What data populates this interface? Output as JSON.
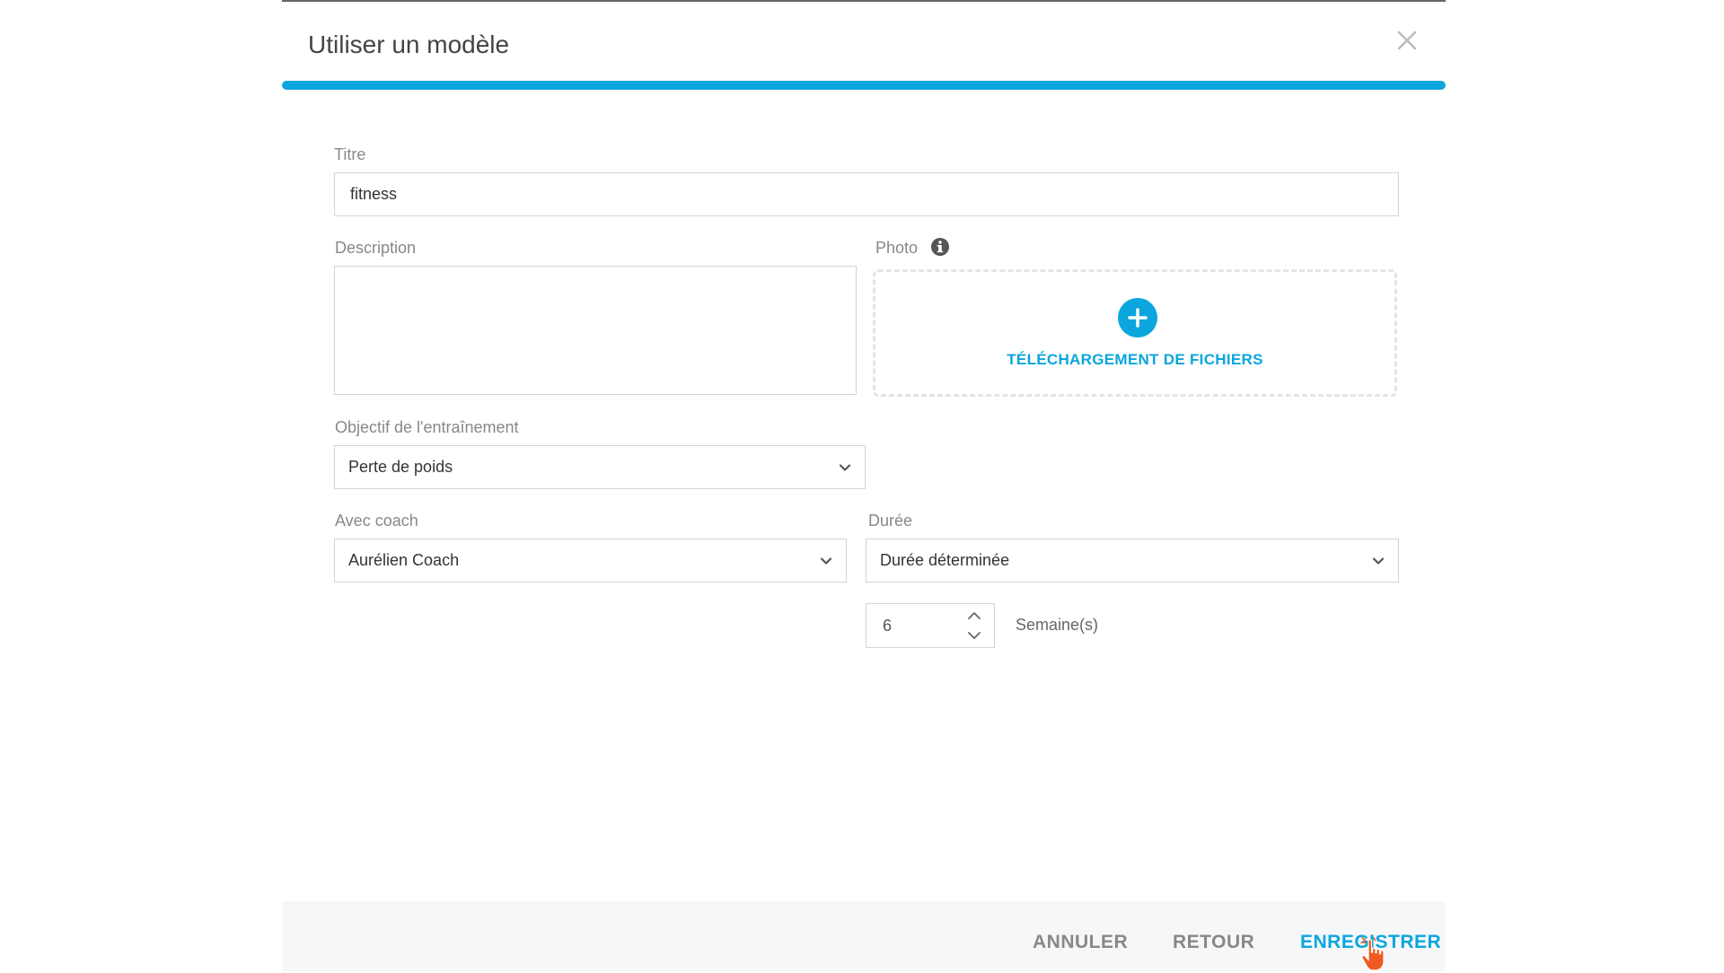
{
  "modal": {
    "title": "Utiliser un modèle",
    "progress_percent": 100
  },
  "form": {
    "title_label": "Titre",
    "title_value": "fitness",
    "description_label": "Description",
    "description_value": "",
    "photo_label": "Photo",
    "upload_label": "TÉLÉCHARGEMENT DE FICHIERS",
    "objective_label": "Objectif de l'entraînement",
    "objective_value": "Perte de poids",
    "coach_label": "Avec coach",
    "coach_value": "Aurélien Coach",
    "duration_label": "Durée",
    "duration_value": "Durée déterminée",
    "weeks_value": "6",
    "weeks_unit": "Semaine(s)"
  },
  "footer": {
    "cancel_label": "ANNULER",
    "back_label": "RETOUR",
    "save_label": "ENREGISTRER"
  },
  "colors": {
    "accent": "#0aa6dd",
    "footer_button": "#888888",
    "cursor": "#f05a22"
  },
  "icons": {
    "close": "close-icon",
    "info": "info-icon",
    "upload": "plus-circle-icon",
    "chevron": "chevron-down-icon",
    "cursor": "hand-pointer-icon"
  }
}
